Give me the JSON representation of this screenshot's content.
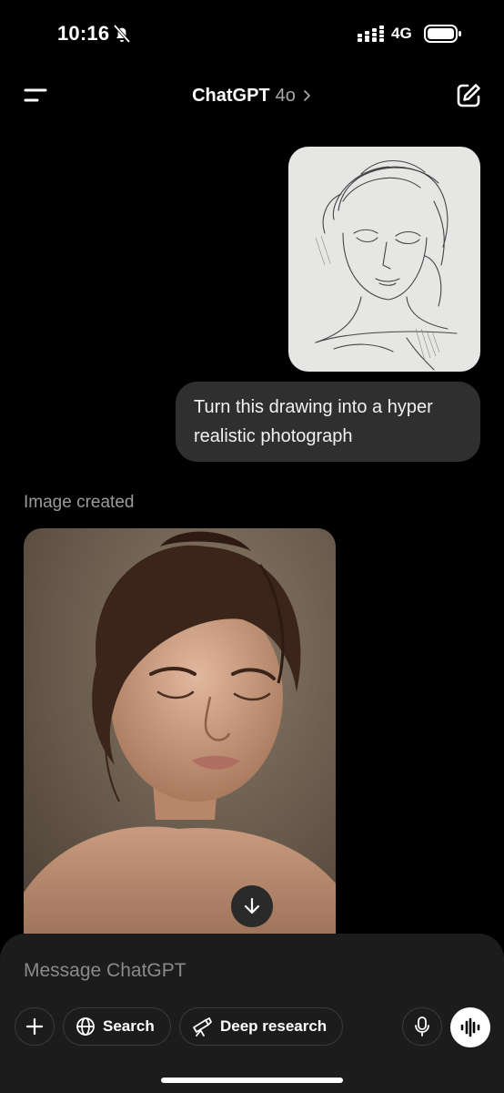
{
  "status_bar": {
    "time": "10:16",
    "network": "4G"
  },
  "header": {
    "title": "ChatGPT",
    "model": "4o"
  },
  "conversation": {
    "user_message": "Turn this drawing into a hyper realistic photograph",
    "assistant_status": "Image created"
  },
  "composer": {
    "placeholder": "Message ChatGPT",
    "search_label": "Search",
    "deep_research_label": "Deep research"
  },
  "icons": {
    "menu": "menu-icon",
    "new_chat": "edit-icon",
    "download": "arrow-down-icon",
    "plus": "plus-icon",
    "globe": "globe-icon",
    "telescope": "telescope-icon",
    "mic": "microphone-icon",
    "voice": "voice-waveform-icon"
  },
  "colors": {
    "background": "#000000",
    "bubble": "#2f2f2f",
    "composer": "#1c1c1c",
    "muted_text": "#9b9b9b"
  }
}
